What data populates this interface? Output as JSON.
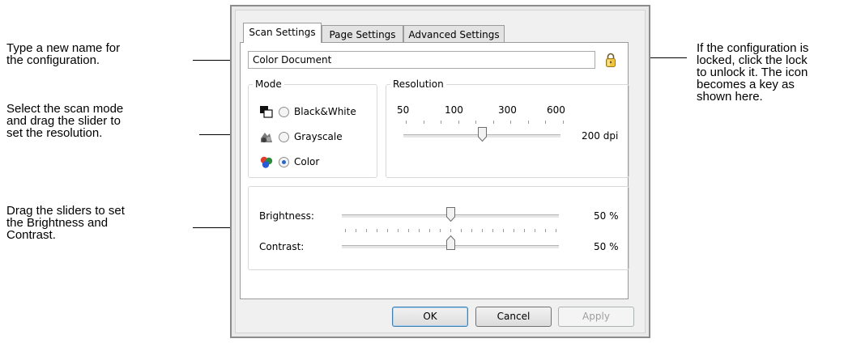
{
  "callouts": {
    "name": [
      "Type a new name for",
      "the configuration."
    ],
    "mode": [
      "Select the scan mode",
      "and drag the slider to",
      "set the resolution."
    ],
    "brightness": [
      "Drag the sliders to set",
      "the Brightness and",
      "Contrast."
    ],
    "lock": [
      "If the configuration is",
      "locked, click the lock",
      "to unlock it. The icon",
      "becomes a key as",
      "shown here."
    ]
  },
  "tabs": [
    "Scan Settings",
    "Page Settings",
    "Advanced Settings"
  ],
  "active_tab": "Scan Settings",
  "config_name": "Color Document",
  "mode": {
    "label": "Mode",
    "options": [
      "Black&White",
      "Grayscale",
      "Color"
    ],
    "selected": "Color"
  },
  "resolution": {
    "label": "Resolution",
    "ticks": [
      "50",
      "100",
      "300",
      "600"
    ],
    "value_label": "200 dpi",
    "value": 200
  },
  "brightness": {
    "label": "Brightness:",
    "value_label": "50 %",
    "value": 50
  },
  "contrast": {
    "label": "Contrast:",
    "value_label": "50 %",
    "value": 50
  },
  "buttons": {
    "ok": "OK",
    "cancel": "Cancel",
    "apply": "Apply"
  },
  "icons": {
    "lock": "padlock-icon",
    "bw": "black-white-mode-icon",
    "gray": "grayscale-mode-icon",
    "color": "color-mode-icon"
  }
}
